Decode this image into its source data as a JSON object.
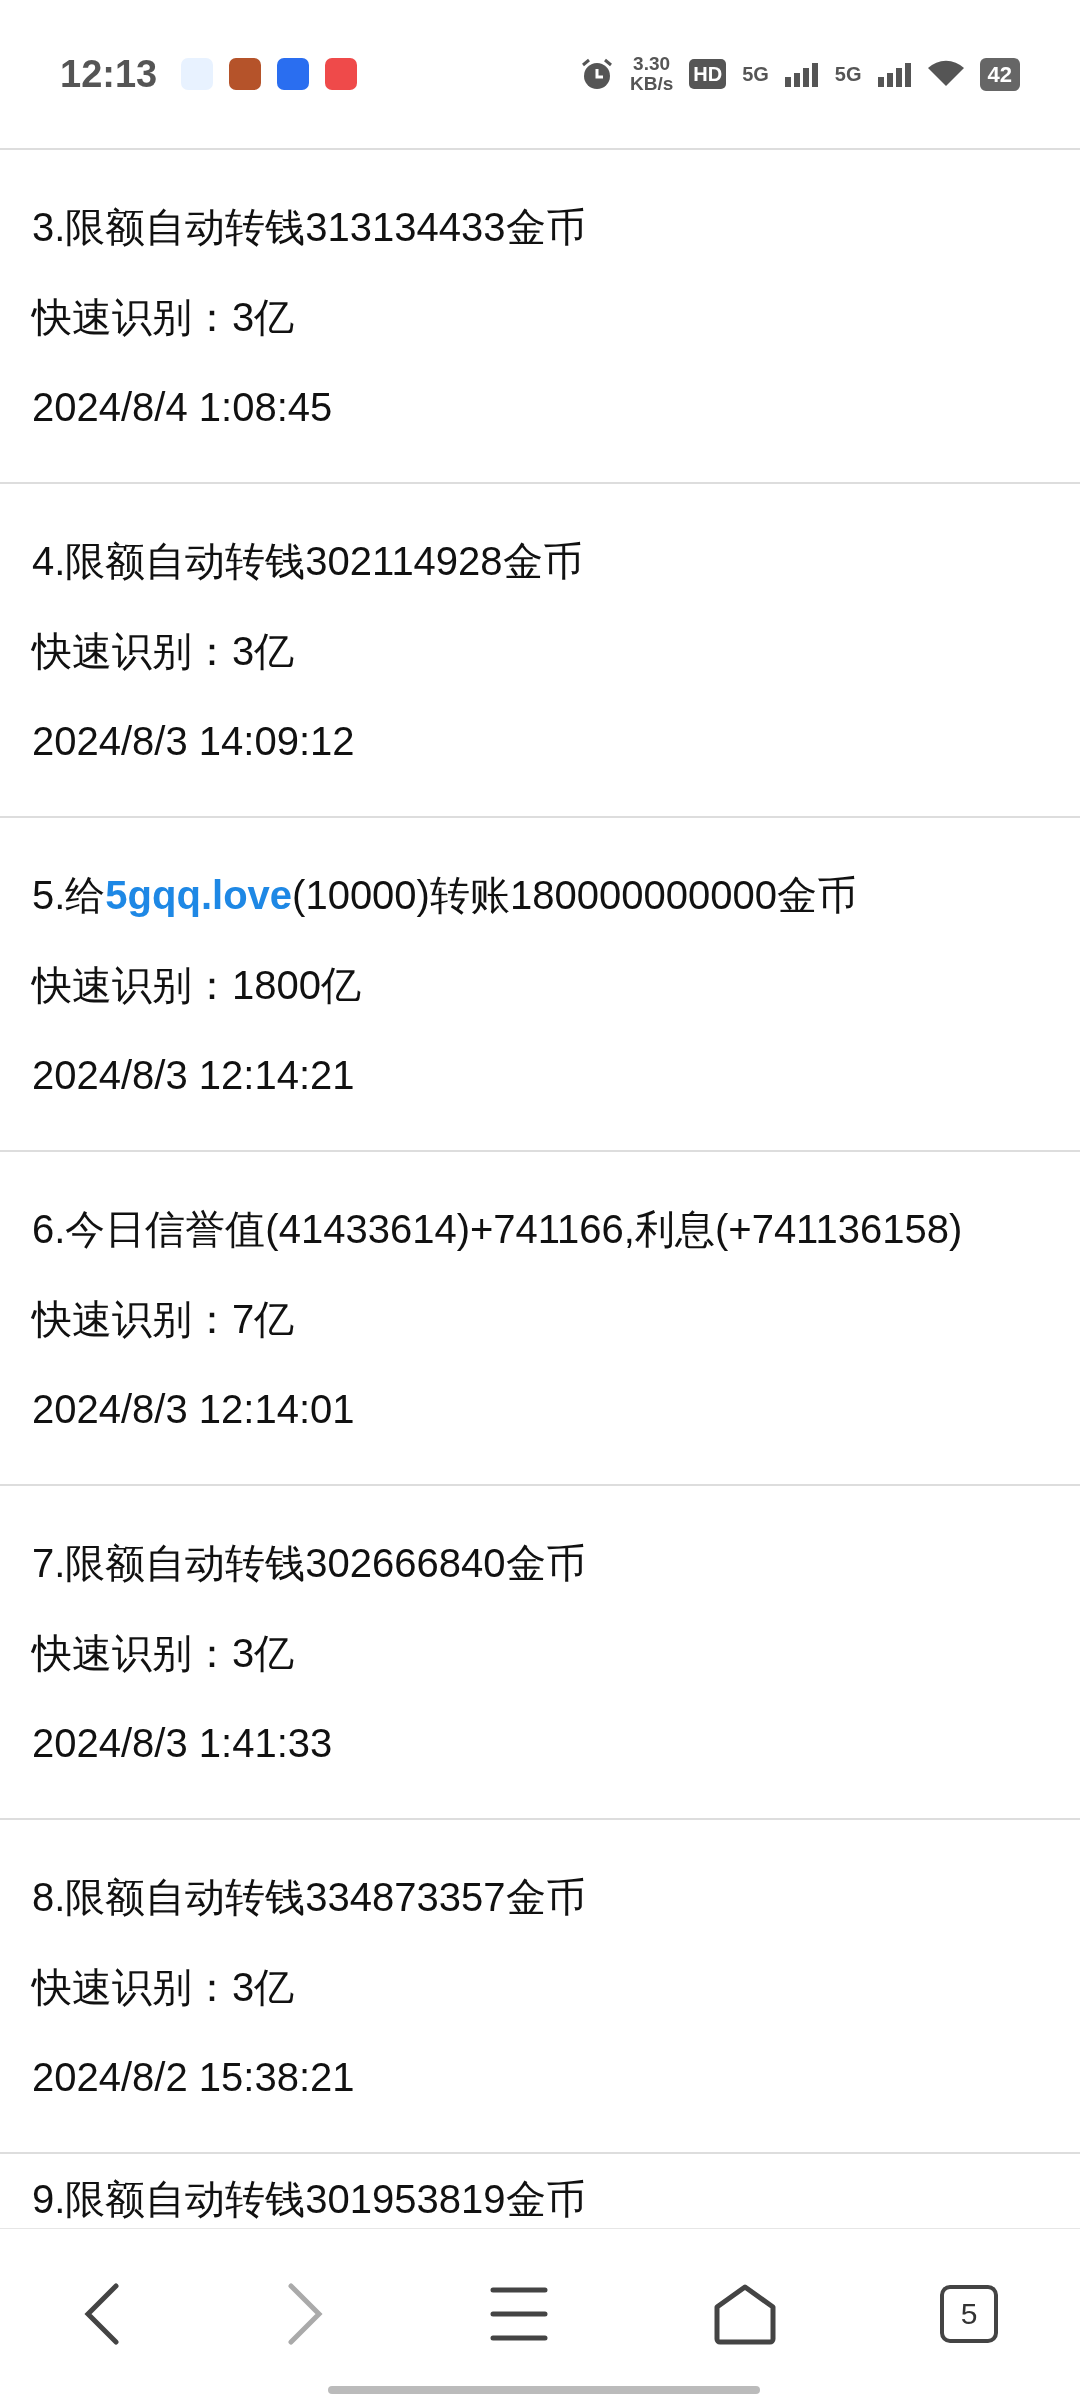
{
  "status_bar": {
    "time": "12:13",
    "net_speed": "3.30",
    "net_unit": "KB/s",
    "hd": "HD",
    "sim1": "5G",
    "sim2": "5G",
    "battery": "42"
  },
  "records": [
    {
      "title": "3.限额自动转钱313134433金币",
      "quick": "快速识别：3亿",
      "time": "2024/8/4 1:08:45"
    },
    {
      "title": "4.限额自动转钱302114928金币",
      "quick": "快速识别：3亿",
      "time": "2024/8/3 14:09:12"
    },
    {
      "title": "5.给**5gqq.love**(10000)转账180000000000金币",
      "quick": "快速识别：1800亿",
      "time": "2024/8/3 12:14:21"
    },
    {
      "title": "6.今日信誉值(41433614)+741166,利息(+741136158)",
      "quick": "快速识别：7亿",
      "time": "2024/8/3 12:14:01"
    },
    {
      "title": "7.限额自动转钱302666840金币",
      "quick": "快速识别：3亿",
      "time": "2024/8/3 1:41:33"
    },
    {
      "title": "8.限额自动转钱334873357金币",
      "quick": "快速识别：3亿",
      "time": "2024/8/2 15:38:21"
    },
    {
      "title": "9.限额自动转钱301953819金币"
    }
  ],
  "toolbar": {
    "back_disabled": false,
    "forward_disabled": true,
    "tab_count": "5"
  }
}
